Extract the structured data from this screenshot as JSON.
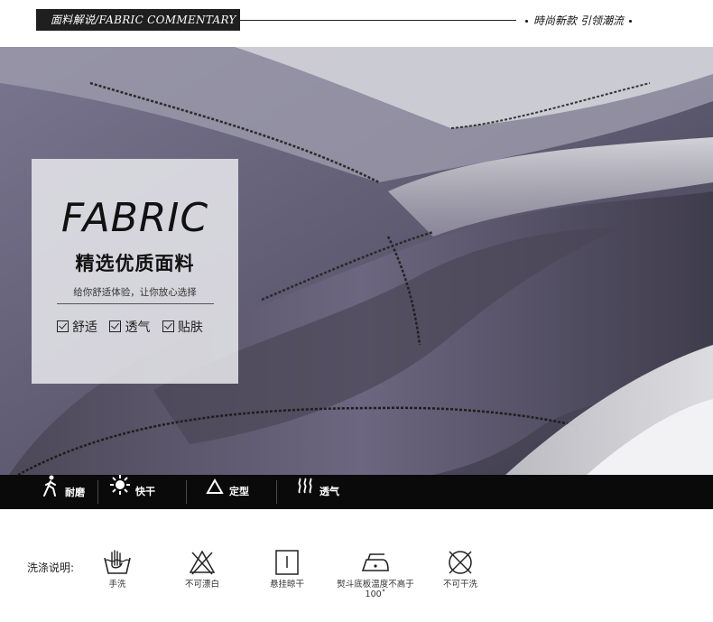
{
  "header": {
    "tag": "面料解说/FABRIC COMMENTARY",
    "slogan": "時尚新款  引领潮流"
  },
  "card": {
    "title": "FABRIC",
    "subtitle": "精选优质面料",
    "description": "给你舒适体验，让你放心选择",
    "checks": [
      "舒适",
      "透气",
      "贴肤"
    ]
  },
  "features": [
    {
      "label": "耐磨",
      "icon": "walking-person-icon"
    },
    {
      "label": "快干",
      "icon": "sun-icon"
    },
    {
      "label": "定型",
      "icon": "triangle-icon"
    },
    {
      "label": "透气",
      "icon": "air-waves-icon"
    }
  ],
  "wash": {
    "label": "洗涤说明:",
    "items": [
      {
        "text": "手洗",
        "icon": "hand-wash-icon"
      },
      {
        "text": "不可漂白",
        "icon": "no-bleach-icon"
      },
      {
        "text": "悬挂晾干",
        "icon": "hang-dry-icon"
      },
      {
        "text": "熨斗底板温度不高于100˚",
        "icon": "iron-low-icon"
      },
      {
        "text": "不可干洗",
        "icon": "no-dry-clean-icon"
      }
    ]
  },
  "colors": {
    "fabric": "#6e6a80",
    "bar": "#0a0a0a",
    "card": "#e8e8ec"
  }
}
